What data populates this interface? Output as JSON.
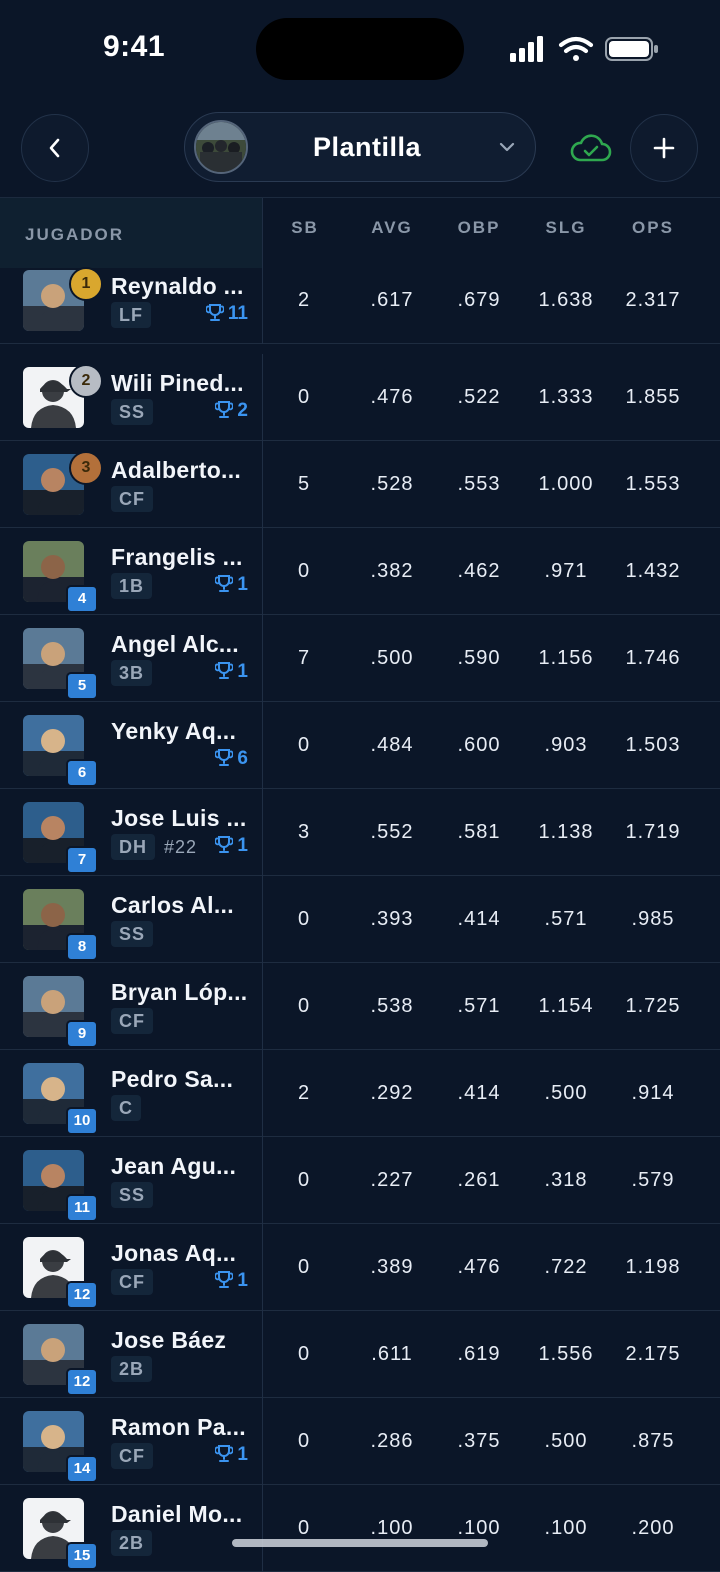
{
  "status": {
    "time": "9:41"
  },
  "header": {
    "team_name": "Plantilla"
  },
  "table": {
    "player_header": "JUGADOR",
    "columns": [
      "SB",
      "AVG",
      "OBP",
      "SLG",
      "OPS"
    ]
  },
  "players": [
    {
      "rank": "1",
      "medal": "gold",
      "name": "Reynaldo ...",
      "pos": "LF",
      "jersey": "",
      "trophies": "11",
      "photo": "photo",
      "stats": [
        "2",
        ".617",
        ".679",
        "1.638",
        "2.317"
      ]
    },
    {
      "rank": "2",
      "medal": "silver",
      "name": "Wili Pined...",
      "pos": "SS",
      "jersey": "",
      "trophies": "2",
      "photo": "placeholder",
      "stats": [
        "0",
        ".476",
        ".522",
        "1.333",
        "1.855"
      ]
    },
    {
      "rank": "3",
      "medal": "bronze",
      "name": "Adalberto...",
      "pos": "CF",
      "jersey": "",
      "trophies": "",
      "photo": "photo",
      "stats": [
        "5",
        ".528",
        ".553",
        "1.000",
        "1.553"
      ]
    },
    {
      "rank": "4",
      "medal": "",
      "name": "Frangelis ...",
      "pos": "1B",
      "jersey": "",
      "trophies": "1",
      "photo": "photo",
      "stats": [
        "0",
        ".382",
        ".462",
        ".971",
        "1.432"
      ]
    },
    {
      "rank": "5",
      "medal": "",
      "name": "Angel Alc...",
      "pos": "3B",
      "jersey": "",
      "trophies": "1",
      "photo": "photo",
      "stats": [
        "7",
        ".500",
        ".590",
        "1.156",
        "1.746"
      ]
    },
    {
      "rank": "6",
      "medal": "",
      "name": "Yenky Aq...",
      "pos": "",
      "jersey": "",
      "trophies": "6",
      "photo": "photo",
      "stats": [
        "0",
        ".484",
        ".600",
        ".903",
        "1.503"
      ]
    },
    {
      "rank": "7",
      "medal": "",
      "name": "Jose Luis ...",
      "pos": "DH",
      "jersey": "#22",
      "trophies": "1",
      "photo": "photo",
      "stats": [
        "3",
        ".552",
        ".581",
        "1.138",
        "1.719"
      ]
    },
    {
      "rank": "8",
      "medal": "",
      "name": "Carlos Al...",
      "pos": "SS",
      "jersey": "",
      "trophies": "",
      "photo": "photo",
      "stats": [
        "0",
        ".393",
        ".414",
        ".571",
        ".985"
      ]
    },
    {
      "rank": "9",
      "medal": "",
      "name": "Bryan Lóp...",
      "pos": "CF",
      "jersey": "",
      "trophies": "",
      "photo": "photo",
      "stats": [
        "0",
        ".538",
        ".571",
        "1.154",
        "1.725"
      ]
    },
    {
      "rank": "10",
      "medal": "",
      "name": "Pedro Sa...",
      "pos": "C",
      "jersey": "",
      "trophies": "",
      "photo": "photo",
      "stats": [
        "2",
        ".292",
        ".414",
        ".500",
        ".914"
      ]
    },
    {
      "rank": "11",
      "medal": "",
      "name": "Jean Agu...",
      "pos": "SS",
      "jersey": "",
      "trophies": "",
      "photo": "photo",
      "stats": [
        "0",
        ".227",
        ".261",
        ".318",
        ".579"
      ]
    },
    {
      "rank": "12",
      "medal": "",
      "name": "Jonas Aq...",
      "pos": "CF",
      "jersey": "",
      "trophies": "1",
      "photo": "placeholder",
      "stats": [
        "0",
        ".389",
        ".476",
        ".722",
        "1.198"
      ]
    },
    {
      "rank": "12",
      "medal": "",
      "name": "Jose Báez",
      "pos": "2B",
      "jersey": "",
      "trophies": "",
      "photo": "photo",
      "stats": [
        "0",
        ".611",
        ".619",
        "1.556",
        "2.175"
      ]
    },
    {
      "rank": "14",
      "medal": "",
      "name": "Ramon Pa...",
      "pos": "CF",
      "jersey": "",
      "trophies": "1",
      "photo": "photo",
      "stats": [
        "0",
        ".286",
        ".375",
        ".500",
        ".875"
      ]
    },
    {
      "rank": "15",
      "medal": "",
      "name": "Daniel Mo...",
      "pos": "2B",
      "jersey": "",
      "trophies": "",
      "photo": "placeholder",
      "stats": [
        "0",
        ".100",
        ".100",
        ".100",
        ".200"
      ]
    }
  ],
  "colors": {
    "background": "#0b1628",
    "accent": "#3b94f0",
    "cloud": "#2fa84f",
    "gold": "#d9a72e",
    "silver": "#b7bcc4",
    "bronze": "#b3703a"
  },
  "icons": [
    "back-chevron-icon",
    "chevron-down-icon",
    "cloud-check-icon",
    "plus-icon",
    "trophy-icon",
    "signal-icon",
    "wifi-icon",
    "battery-icon"
  ]
}
